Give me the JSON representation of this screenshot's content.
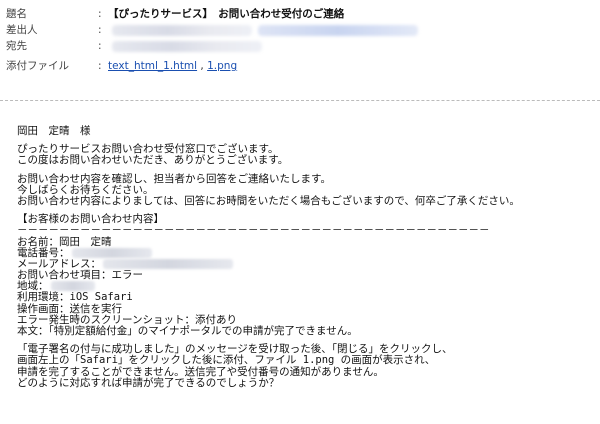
{
  "header": {
    "subject_label": "題名",
    "subject_value": "【ぴったりサービス】　お問い合わせ受付のご連絡",
    "from_label": "差出人",
    "to_label": "宛先",
    "attach_label": "添付ファイル",
    "colon": ":",
    "attachments": [
      "text_html_1.html",
      "1.png"
    ],
    "attach_sep": ","
  },
  "body": {
    "greeting": "岡田　定晴　様",
    "p1": [
      "ぴったりサービスお問い合わせ受付窓口でございます。",
      "この度はお問い合わせいただき、ありがとうございます。"
    ],
    "p2": [
      "お問い合わせ内容を確認し、担当者から回答をご連絡いたします。",
      "今しばらくお待ちください。",
      "お問い合わせ内容によりましては、回答にお時間をいただく場合もございますので、何卒ご了承ください。"
    ],
    "section_title": "【お客様のお問い合わせ内容】",
    "rule": "－－－－－－－－－－－－－－－－－－－－－－－－－－－－－－－－－－－－－－－－－－－－－",
    "name_line": "お名前：岡田　定晴",
    "phone_label": "電話番号：",
    "mail_label": "メールアドレス：",
    "item_line": "お問い合わせ項目：エラー",
    "region_label": "地域：",
    "env_line": "利用環境：iOS Safari",
    "screen_line": "操作画面：送信を実行",
    "shot_line": "エラー発生時のスクリーンショット：添付あり",
    "text_line": "本文：「特別定額給付金」のマイナポータルでの申請が完了できません。",
    "p3": [
      "「電子署名の付与に成功しました」のメッセージを受け取った後、「閉じる」をクリックし、",
      "画面左上の「Safari」をクリックした後に添付、ファイル 1.png の画面が表示され、",
      "申請を完了することができません。送信完了や受付番号の通知がありません。",
      "どのように対応すれば申請が完了できるのでしょうか？"
    ]
  }
}
